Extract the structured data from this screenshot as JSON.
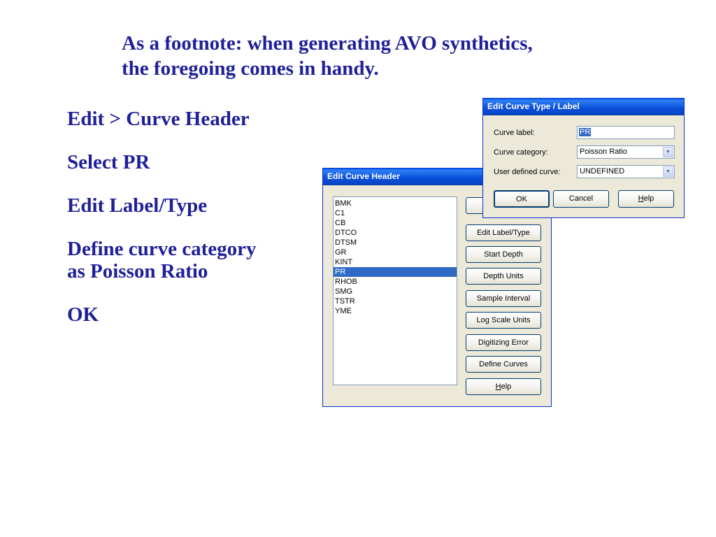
{
  "slide": {
    "title_line1": "As a footnote: when generating AVO synthetics,",
    "title_line2": "the foregoing comes in handy.",
    "steps": [
      {
        "lines": [
          "Edit > Curve Header"
        ]
      },
      {
        "lines": [
          "Select PR"
        ]
      },
      {
        "lines": [
          "Edit Label/Type"
        ]
      },
      {
        "lines": [
          "Define curve category",
          "as Poisson Ratio"
        ]
      },
      {
        "lines": [
          "OK"
        ]
      }
    ]
  },
  "header_dialog": {
    "title": "Edit Curve Header",
    "curves": [
      "BMK",
      "C1",
      "CB",
      "DTCO",
      "DTSM",
      "GR",
      "KINT",
      "PR",
      "RHOB",
      "SMG",
      "TSTR",
      "YME"
    ],
    "selected_curve": "PR",
    "buttons": {
      "edit_label_type": "Edit Label/Type",
      "start_depth": "Start Depth",
      "depth_units": "Depth Units",
      "sample_interval": "Sample Interval",
      "log_scale_units": "Log Scale Units",
      "digitizing_error": "Digitizing Error",
      "define_curves": "Define Curves",
      "help_rest": "elp",
      "help_mnemonic": "H"
    }
  },
  "type_dialog": {
    "title": "Edit Curve Type / Label",
    "curve_label_caption": "Curve label:",
    "curve_label_value": "PR",
    "curve_category_caption": "Curve category:",
    "curve_category_value": "Poisson Ratio",
    "user_defined_caption": "User defined curve:",
    "user_defined_value": "UNDEFINED",
    "ok": "OK",
    "cancel": "Cancel",
    "help_mnemonic": "H",
    "help_rest": "elp"
  },
  "colors": {
    "slide_text": "#1f1f9a",
    "titlebar": "#0a4fd8",
    "selection": "#316ac5",
    "dialog_bg": "#ece9d8"
  }
}
